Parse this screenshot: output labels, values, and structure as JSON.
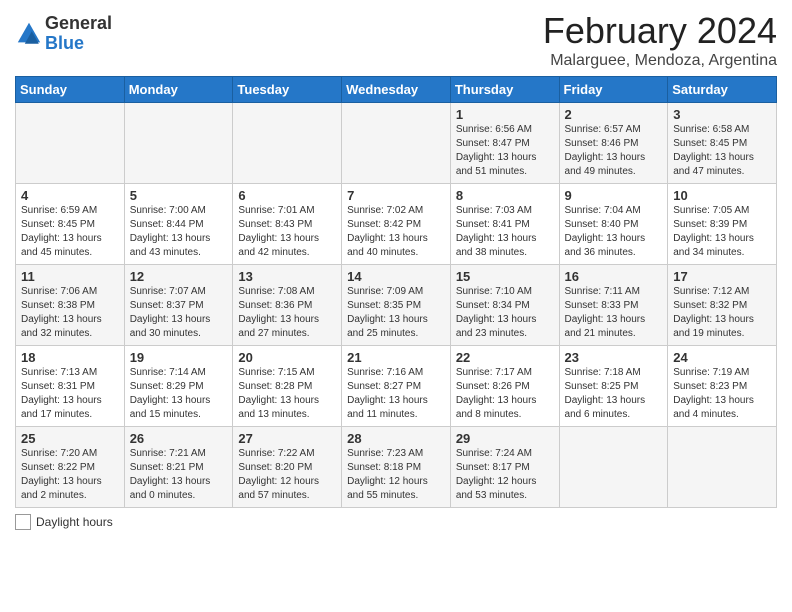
{
  "logo": {
    "general": "General",
    "blue": "Blue"
  },
  "title": "February 2024",
  "subtitle": "Malarguee, Mendoza, Argentina",
  "days_of_week": [
    "Sunday",
    "Monday",
    "Tuesday",
    "Wednesday",
    "Thursday",
    "Friday",
    "Saturday"
  ],
  "legend_label": "Daylight hours",
  "weeks": [
    [
      {
        "num": "",
        "info": ""
      },
      {
        "num": "",
        "info": ""
      },
      {
        "num": "",
        "info": ""
      },
      {
        "num": "",
        "info": ""
      },
      {
        "num": "1",
        "info": "Sunrise: 6:56 AM\nSunset: 8:47 PM\nDaylight: 13 hours\nand 51 minutes."
      },
      {
        "num": "2",
        "info": "Sunrise: 6:57 AM\nSunset: 8:46 PM\nDaylight: 13 hours\nand 49 minutes."
      },
      {
        "num": "3",
        "info": "Sunrise: 6:58 AM\nSunset: 8:45 PM\nDaylight: 13 hours\nand 47 minutes."
      }
    ],
    [
      {
        "num": "4",
        "info": "Sunrise: 6:59 AM\nSunset: 8:45 PM\nDaylight: 13 hours\nand 45 minutes."
      },
      {
        "num": "5",
        "info": "Sunrise: 7:00 AM\nSunset: 8:44 PM\nDaylight: 13 hours\nand 43 minutes."
      },
      {
        "num": "6",
        "info": "Sunrise: 7:01 AM\nSunset: 8:43 PM\nDaylight: 13 hours\nand 42 minutes."
      },
      {
        "num": "7",
        "info": "Sunrise: 7:02 AM\nSunset: 8:42 PM\nDaylight: 13 hours\nand 40 minutes."
      },
      {
        "num": "8",
        "info": "Sunrise: 7:03 AM\nSunset: 8:41 PM\nDaylight: 13 hours\nand 38 minutes."
      },
      {
        "num": "9",
        "info": "Sunrise: 7:04 AM\nSunset: 8:40 PM\nDaylight: 13 hours\nand 36 minutes."
      },
      {
        "num": "10",
        "info": "Sunrise: 7:05 AM\nSunset: 8:39 PM\nDaylight: 13 hours\nand 34 minutes."
      }
    ],
    [
      {
        "num": "11",
        "info": "Sunrise: 7:06 AM\nSunset: 8:38 PM\nDaylight: 13 hours\nand 32 minutes."
      },
      {
        "num": "12",
        "info": "Sunrise: 7:07 AM\nSunset: 8:37 PM\nDaylight: 13 hours\nand 30 minutes."
      },
      {
        "num": "13",
        "info": "Sunrise: 7:08 AM\nSunset: 8:36 PM\nDaylight: 13 hours\nand 27 minutes."
      },
      {
        "num": "14",
        "info": "Sunrise: 7:09 AM\nSunset: 8:35 PM\nDaylight: 13 hours\nand 25 minutes."
      },
      {
        "num": "15",
        "info": "Sunrise: 7:10 AM\nSunset: 8:34 PM\nDaylight: 13 hours\nand 23 minutes."
      },
      {
        "num": "16",
        "info": "Sunrise: 7:11 AM\nSunset: 8:33 PM\nDaylight: 13 hours\nand 21 minutes."
      },
      {
        "num": "17",
        "info": "Sunrise: 7:12 AM\nSunset: 8:32 PM\nDaylight: 13 hours\nand 19 minutes."
      }
    ],
    [
      {
        "num": "18",
        "info": "Sunrise: 7:13 AM\nSunset: 8:31 PM\nDaylight: 13 hours\nand 17 minutes."
      },
      {
        "num": "19",
        "info": "Sunrise: 7:14 AM\nSunset: 8:29 PM\nDaylight: 13 hours\nand 15 minutes."
      },
      {
        "num": "20",
        "info": "Sunrise: 7:15 AM\nSunset: 8:28 PM\nDaylight: 13 hours\nand 13 minutes."
      },
      {
        "num": "21",
        "info": "Sunrise: 7:16 AM\nSunset: 8:27 PM\nDaylight: 13 hours\nand 11 minutes."
      },
      {
        "num": "22",
        "info": "Sunrise: 7:17 AM\nSunset: 8:26 PM\nDaylight: 13 hours\nand 8 minutes."
      },
      {
        "num": "23",
        "info": "Sunrise: 7:18 AM\nSunset: 8:25 PM\nDaylight: 13 hours\nand 6 minutes."
      },
      {
        "num": "24",
        "info": "Sunrise: 7:19 AM\nSunset: 8:23 PM\nDaylight: 13 hours\nand 4 minutes."
      }
    ],
    [
      {
        "num": "25",
        "info": "Sunrise: 7:20 AM\nSunset: 8:22 PM\nDaylight: 13 hours\nand 2 minutes."
      },
      {
        "num": "26",
        "info": "Sunrise: 7:21 AM\nSunset: 8:21 PM\nDaylight: 13 hours\nand 0 minutes."
      },
      {
        "num": "27",
        "info": "Sunrise: 7:22 AM\nSunset: 8:20 PM\nDaylight: 12 hours\nand 57 minutes."
      },
      {
        "num": "28",
        "info": "Sunrise: 7:23 AM\nSunset: 8:18 PM\nDaylight: 12 hours\nand 55 minutes."
      },
      {
        "num": "29",
        "info": "Sunrise: 7:24 AM\nSunset: 8:17 PM\nDaylight: 12 hours\nand 53 minutes."
      },
      {
        "num": "",
        "info": ""
      },
      {
        "num": "",
        "info": ""
      }
    ]
  ]
}
